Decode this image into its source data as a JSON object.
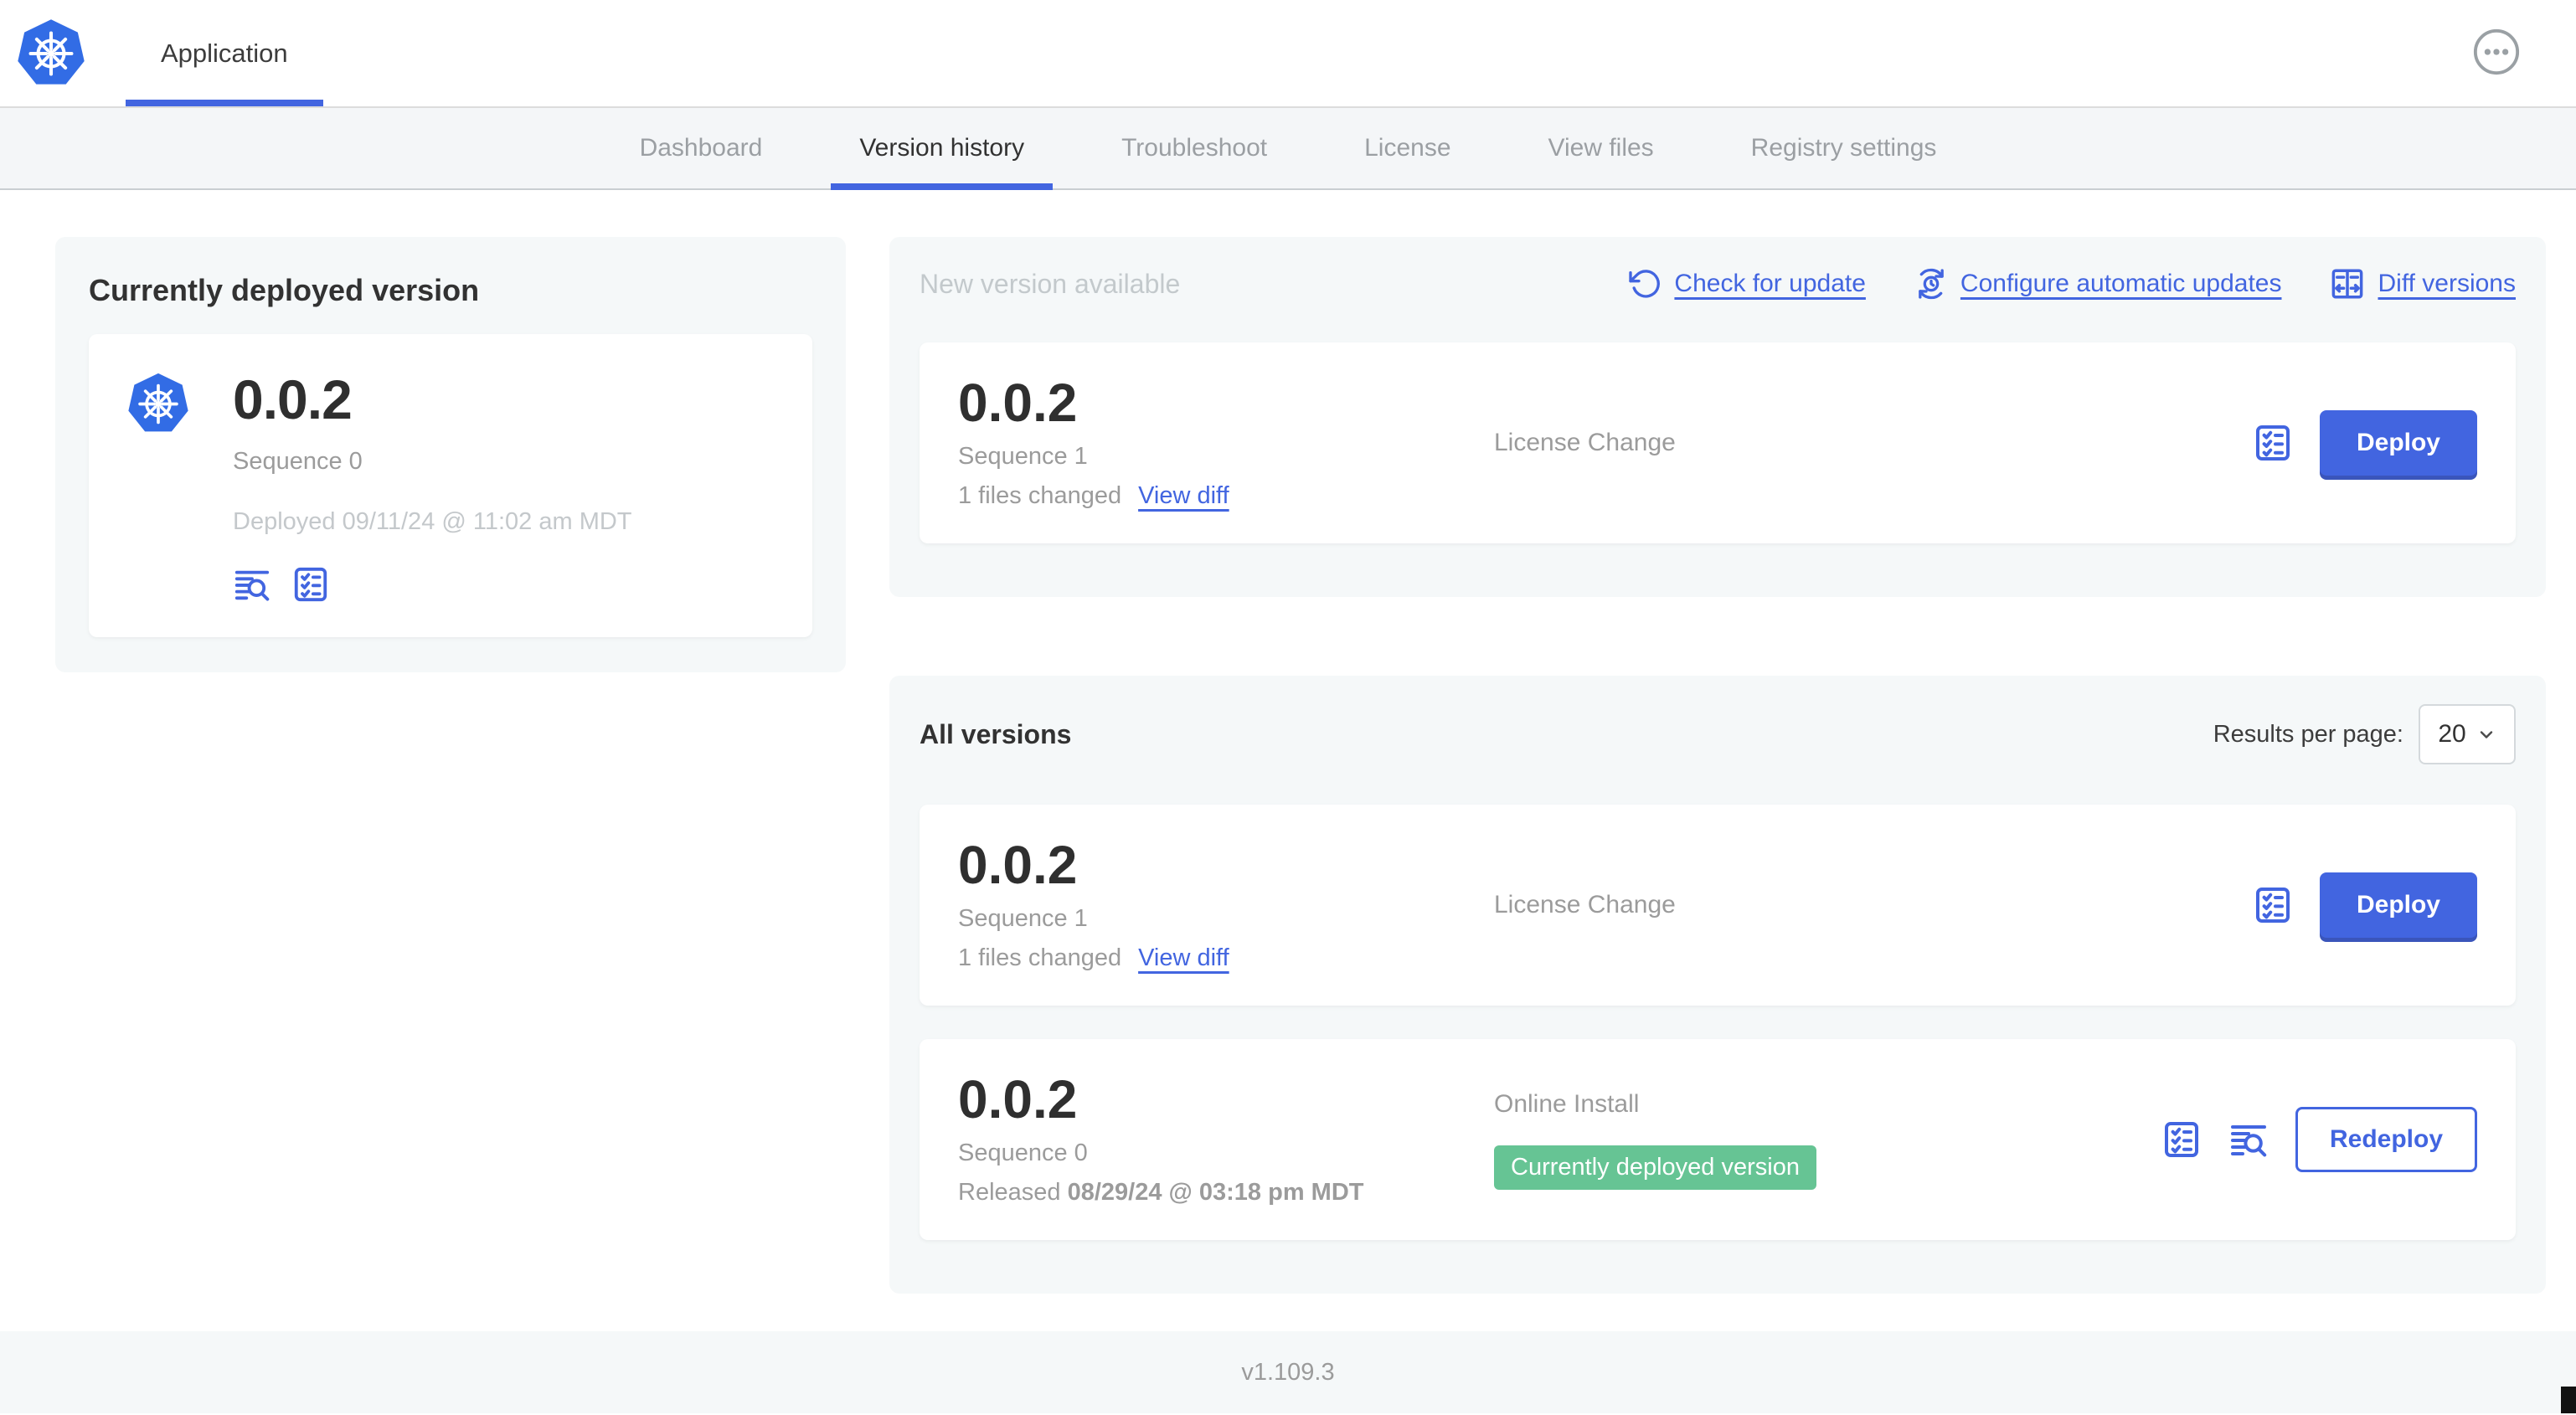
{
  "header": {
    "app_title": "Application"
  },
  "nav": {
    "tabs": [
      {
        "label": "Dashboard",
        "active": false
      },
      {
        "label": "Version history",
        "active": true
      },
      {
        "label": "Troubleshoot",
        "active": false
      },
      {
        "label": "License",
        "active": false
      },
      {
        "label": "View files",
        "active": false
      },
      {
        "label": "Registry settings",
        "active": false
      }
    ]
  },
  "current_card": {
    "title": "Currently deployed version",
    "version": "0.0.2",
    "sequence": "Sequence 0",
    "deployed": "Deployed 09/11/24 @ 11:02 am MDT"
  },
  "new_version": {
    "title": "New version available",
    "actions": {
      "check_for_update": "Check for update",
      "configure_updates": "Configure automatic updates",
      "diff_versions": "Diff versions"
    },
    "row": {
      "version": "0.0.2",
      "sequence": "Sequence 1",
      "files_changed": "1 files changed",
      "view_diff": "View diff",
      "source": "License Change",
      "deploy": "Deploy"
    }
  },
  "all_versions": {
    "title": "All versions",
    "per_page_label": "Results per page:",
    "per_page_value": "20",
    "rows": [
      {
        "version": "0.0.2",
        "sequence": "Sequence 1",
        "files_changed": "1 files changed",
        "view_diff": "View diff",
        "source": "License Change",
        "deploy": "Deploy"
      },
      {
        "version": "0.0.2",
        "sequence": "Sequence 0",
        "released_prefix": "Released ",
        "released_date": "08/29/24 @ 03:18 pm MDT",
        "source": "Online Install",
        "badge": "Currently deployed version",
        "redeploy": "Redeploy"
      }
    ]
  },
  "footer": {
    "version": "v1.109.3"
  },
  "icons": {
    "more": "ellipsis-in-circle",
    "check_for_update": "rotate-ccw-arrow",
    "configure_updates": "clock-with-sync-arrows",
    "diff_versions": "split-pane-arrows",
    "logs": "log-lines-magnifier",
    "preflight": "checklist",
    "select_caret": "chevron-down",
    "app_logo": "kubernetes-helm-wheel"
  },
  "colors": {
    "accent_blue": "#4265E0",
    "logo_blue": "#326CE5",
    "badge_green": "#66C494",
    "panel_gray": "#F5F8F9"
  }
}
